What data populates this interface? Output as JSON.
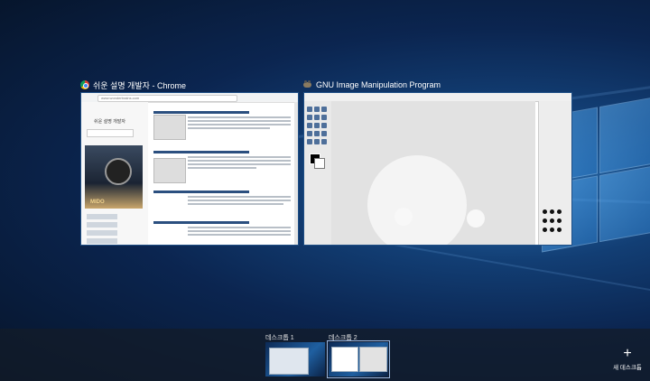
{
  "windows": [
    {
      "title": "쉬운 설명 개발자 - Chrome",
      "icon": "chrome-icon",
      "url": "www.wonderbrains.com"
    },
    {
      "title": "GNU Image Manipulation Program",
      "icon": "gimp-icon"
    }
  ],
  "chrome_page": {
    "site_title": "쉬운 설명 개발자",
    "ad_brand": "MIDO"
  },
  "desktops": [
    {
      "label": "데스크톱 1",
      "active": false
    },
    {
      "label": "데스크톱 2",
      "active": true
    }
  ],
  "new_desktop": {
    "label": "새 데스크톱",
    "icon": "plus-icon"
  },
  "colors": {
    "wallpaper_dark": "#061429",
    "wallpaper_light": "#2a6fb0",
    "strip": "#141c28"
  }
}
